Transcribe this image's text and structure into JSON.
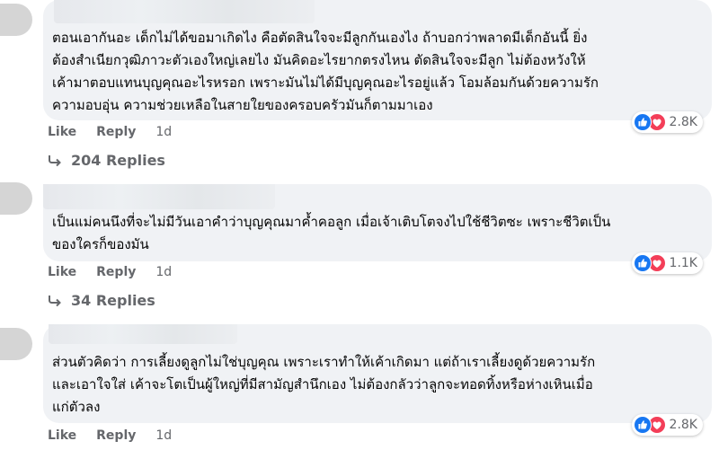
{
  "comments": [
    {
      "text": "ตอนเอากันอะ เด็กไม่ได้ขอมาเกิดไง คือตัดสินใจจะมีลูกกันเองไง ถ้าบอกว่าพลาดมีเด็กอันนี้ ยิ่ง\nต้องสำเนียกวุฒิภาวะตัวเองใหญ่เลยไง มันคิดอะไรยากตรงไหน ตัดสินใจจะมีลูก ไม่ต้องหวังให้\nเค้ามาตอบแทนบุญคุณอะไรหรอก เพราะมันไม่ได้มีบุญคุณอะไรอยู่แล้ว โอมล้อมกันด้วยความรัก\nความอบอุ่น ความช่วยเหลือในสายใยของครอบครัวมันก็ตามมาเอง",
      "like_label": "Like",
      "reply_label": "Reply",
      "time": "1d",
      "reaction_count": "2.8K",
      "replies_label": "204 Replies"
    },
    {
      "text": "เป็นแม่คนนึงที่จะไม่มีวันเอาคำว่าบุญคุณมาค้ำคอลูก เมื่อเจ้าเติบโตจงไปใช้ชีวิตซะ เพราะชีวิตเป็น\nของใครก็ของมัน",
      "like_label": "Like",
      "reply_label": "Reply",
      "time": "1d",
      "reaction_count": "1.1K",
      "replies_label": "34 Replies"
    },
    {
      "text": "ส่วนตัวคิดว่า การเลี้ยงดูลูกไม่ใช่บุญคุณ เพราะเราทำให้เค้าเกิดมา แต่ถ้าเราเลี้ยงดูด้วยความรัก\nและเอาใจใส่ เค้าจะโตเป็นผู้ใหญ่ที่มีสามัญสำนึกเอง ไม่ต้องกลัวว่าลูกจะทอดทิ้งหรือห่างเหินเมื่อ\nแก่ตัวลง",
      "like_label": "Like",
      "reply_label": "Reply",
      "time": "1d",
      "reaction_count": "2.8K"
    }
  ],
  "icons": {
    "like": "like-reaction-icon",
    "love": "love-reaction-icon",
    "reply_arrow": "reply-arrow-icon"
  },
  "colors": {
    "bubble": "#f0f2f5",
    "meta_text": "#65676b",
    "like_blue": "#1877f2",
    "love_red": "#f33e58"
  }
}
